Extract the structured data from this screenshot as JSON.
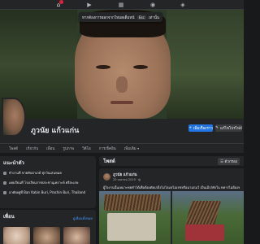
{
  "colors": {
    "accent": "#2374e1",
    "link": "#4599ff",
    "bg": "#18191a",
    "card": "#242526",
    "notification": "#e41e3f"
  },
  "topnav": {
    "icons": [
      "home-icon",
      "video-icon",
      "marketplace-icon",
      "groups-icon",
      "gaming-icon"
    ]
  },
  "toast": {
    "text": "หากต้องการออกจากโหมดเต็มหน้าจอ ให้กด",
    "key": "Esc",
    "suffix": "เท่านั้น"
  },
  "profile": {
    "name": "ภูวนัย แก้วแก่น"
  },
  "buttons": {
    "add_story": "เพิ่มเรื่องราว",
    "edit_profile": "แก้ไขโปรไฟล์"
  },
  "tabs": [
    "โพสต์",
    "เกี่ยวกับ",
    "เพื่อน",
    "รูปภาพ",
    "วิดีโอ",
    "การเช็คอิน",
    "เพิ่มเติม"
  ],
  "intro": {
    "title": "แนะนำตัว",
    "lines": [
      "ทำงานที่ ขายทับตาเกย์ ทุกวันเล่นหมด",
      "เคยเรียนที่ โรงเรียนราชประชานุเคราะห์ ศรีสะเกษ",
      "อาศัยอยู่ที่ Ban Kabin Buri, Prachin Buri, Thailand"
    ]
  },
  "friends": {
    "title": "เพื่อน",
    "see_all": "ดูเพื่อนทั้งหมด"
  },
  "posts": {
    "title": "โพสต์",
    "filter": "ตัวกรอง",
    "author": "ภูวนัย แก้วแก่น",
    "date": "20 เมษายน 2019 · ",
    "caption": "ผู้ใจงานนั้นเหมาะทยทำได้เพื่อต้องตัดเกล็งไม่ไลมจไม่เรชหรือมามกมว้ เป็นเม็ก/พักใน ทหารไม่ต้องทาง"
  }
}
